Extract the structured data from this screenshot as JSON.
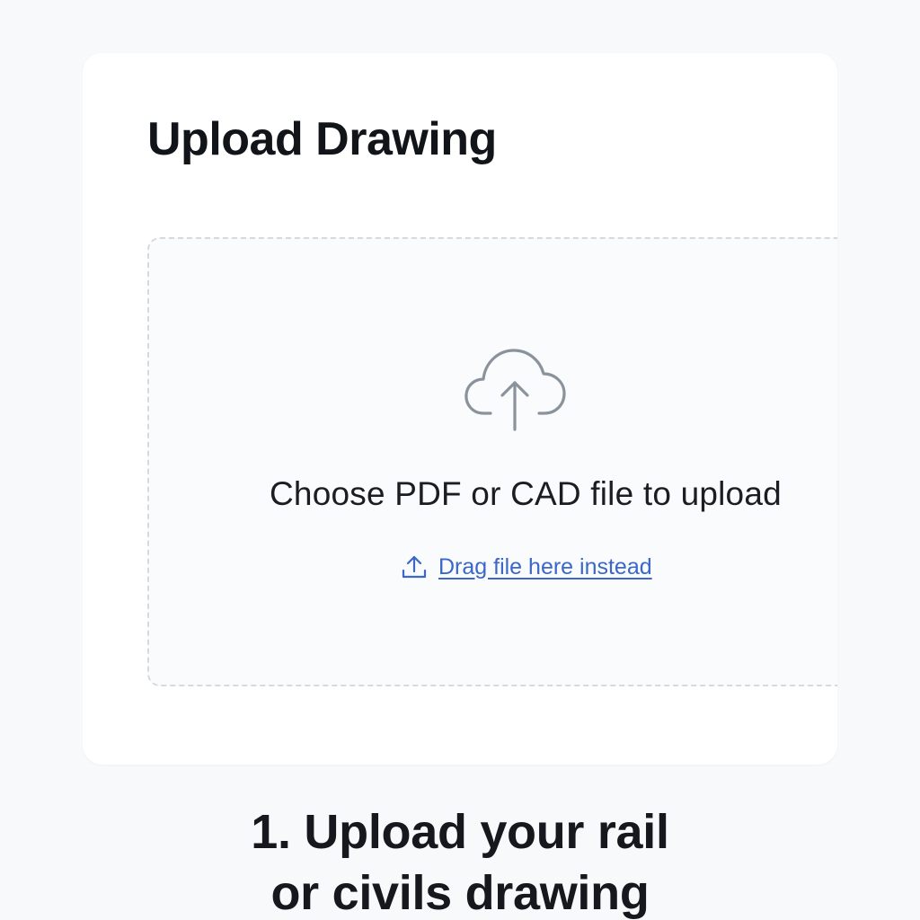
{
  "card": {
    "title": "Upload Drawing",
    "dropzone": {
      "icon": "cloud-upload-icon",
      "prompt": "Choose PDF or CAD file to upload",
      "drag_link": {
        "icon": "upload-icon",
        "label": "Drag file here instead"
      }
    }
  },
  "caption": {
    "line1": "1. Upload your rail",
    "line2": "or civils drawing"
  },
  "colors": {
    "background": "#f8f9fb",
    "card": "#ffffff",
    "link": "#3b67c8",
    "icon_gray": "#8a939c",
    "dashed_border": "#d3dae1"
  }
}
